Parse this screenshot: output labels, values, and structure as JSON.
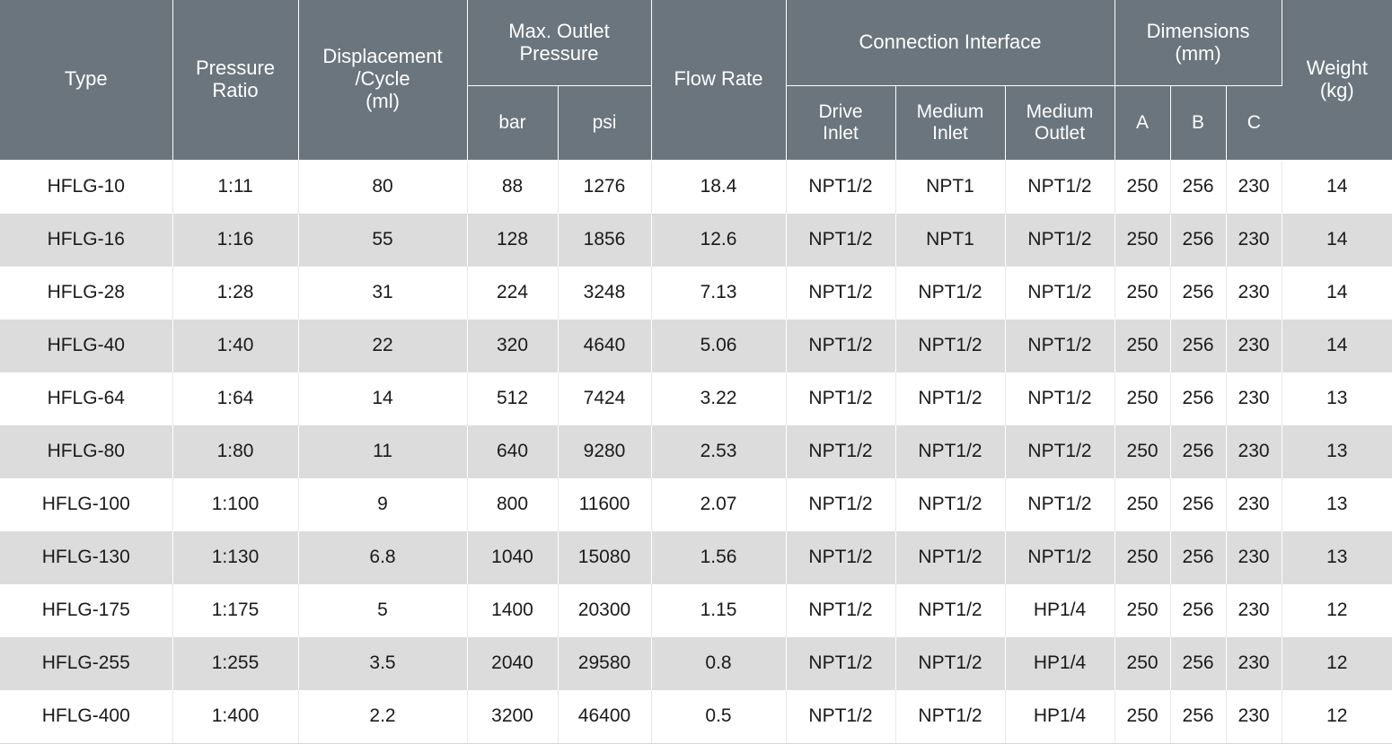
{
  "table": {
    "headers": {
      "type": "Type",
      "pressure_ratio": "Pressure\nRatio",
      "pressure_ratio_l1": "Pressure",
      "pressure_ratio_l2": "Ratio",
      "displacement_l1": "Displacement",
      "displacement_l2": "/Cycle",
      "displacement_l3": "(ml)",
      "max_outlet_pressure_l1": "Max. Outlet",
      "max_outlet_pressure_l2": "Pressure",
      "bar": "bar",
      "psi": "psi",
      "flow_rate": "Flow Rate",
      "connection_interface": "Connection Interface",
      "drive_inlet_l1": "Drive",
      "drive_inlet_l2": "Inlet",
      "medium_inlet_l1": "Medium",
      "medium_inlet_l2": "Inlet",
      "medium_outlet_l1": "Medium",
      "medium_outlet_l2": "Outlet",
      "dimensions_l1": "Dimensions",
      "dimensions_l2": "(mm)",
      "dim_a": "A",
      "dim_b": "B",
      "dim_c": "C",
      "weight_l1": "Weight",
      "weight_l2": "(kg)"
    },
    "rows": [
      {
        "type": "HFLG-10",
        "pressure_ratio": "1:11",
        "displacement": "80",
        "bar": "88",
        "psi": "1276",
        "flow_rate": "18.4",
        "drive_inlet": "NPT1/2",
        "medium_inlet": "NPT1",
        "medium_outlet": "NPT1/2",
        "a": "250",
        "b": "256",
        "c": "230",
        "weight": "14"
      },
      {
        "type": "HFLG-16",
        "pressure_ratio": "1:16",
        "displacement": "55",
        "bar": "128",
        "psi": "1856",
        "flow_rate": "12.6",
        "drive_inlet": "NPT1/2",
        "medium_inlet": "NPT1",
        "medium_outlet": "NPT1/2",
        "a": "250",
        "b": "256",
        "c": "230",
        "weight": "14"
      },
      {
        "type": "HFLG-28",
        "pressure_ratio": "1:28",
        "displacement": "31",
        "bar": "224",
        "psi": "3248",
        "flow_rate": "7.13",
        "drive_inlet": "NPT1/2",
        "medium_inlet": "NPT1/2",
        "medium_outlet": "NPT1/2",
        "a": "250",
        "b": "256",
        "c": "230",
        "weight": "14"
      },
      {
        "type": "HFLG-40",
        "pressure_ratio": "1:40",
        "displacement": "22",
        "bar": "320",
        "psi": "4640",
        "flow_rate": "5.06",
        "drive_inlet": "NPT1/2",
        "medium_inlet": "NPT1/2",
        "medium_outlet": "NPT1/2",
        "a": "250",
        "b": "256",
        "c": "230",
        "weight": "14"
      },
      {
        "type": "HFLG-64",
        "pressure_ratio": "1:64",
        "displacement": "14",
        "bar": "512",
        "psi": "7424",
        "flow_rate": "3.22",
        "drive_inlet": "NPT1/2",
        "medium_inlet": "NPT1/2",
        "medium_outlet": "NPT1/2",
        "a": "250",
        "b": "256",
        "c": "230",
        "weight": "13"
      },
      {
        "type": "HFLG-80",
        "pressure_ratio": "1:80",
        "displacement": "11",
        "bar": "640",
        "psi": "9280",
        "flow_rate": "2.53",
        "drive_inlet": "NPT1/2",
        "medium_inlet": "NPT1/2",
        "medium_outlet": "NPT1/2",
        "a": "250",
        "b": "256",
        "c": "230",
        "weight": "13"
      },
      {
        "type": "HFLG-100",
        "pressure_ratio": "1:100",
        "displacement": "9",
        "bar": "800",
        "psi": "11600",
        "flow_rate": "2.07",
        "drive_inlet": "NPT1/2",
        "medium_inlet": "NPT1/2",
        "medium_outlet": "NPT1/2",
        "a": "250",
        "b": "256",
        "c": "230",
        "weight": "13"
      },
      {
        "type": "HFLG-130",
        "pressure_ratio": "1:130",
        "displacement": "6.8",
        "bar": "1040",
        "psi": "15080",
        "flow_rate": "1.56",
        "drive_inlet": "NPT1/2",
        "medium_inlet": "NPT1/2",
        "medium_outlet": "NPT1/2",
        "a": "250",
        "b": "256",
        "c": "230",
        "weight": "13"
      },
      {
        "type": "HFLG-175",
        "pressure_ratio": "1:175",
        "displacement": "5",
        "bar": "1400",
        "psi": "20300",
        "flow_rate": "1.15",
        "drive_inlet": "NPT1/2",
        "medium_inlet": "NPT1/2",
        "medium_outlet": "HP1/4",
        "a": "250",
        "b": "256",
        "c": "230",
        "weight": "12"
      },
      {
        "type": "HFLG-255",
        "pressure_ratio": "1:255",
        "displacement": "3.5",
        "bar": "2040",
        "psi": "29580",
        "flow_rate": "0.8",
        "drive_inlet": "NPT1/2",
        "medium_inlet": "NPT1/2",
        "medium_outlet": "HP1/4",
        "a": "250",
        "b": "256",
        "c": "230",
        "weight": "12"
      },
      {
        "type": "HFLG-400",
        "pressure_ratio": "1:400",
        "displacement": "2.2",
        "bar": "3200",
        "psi": "46400",
        "flow_rate": "0.5",
        "drive_inlet": "NPT1/2",
        "medium_inlet": "NPT1/2",
        "medium_outlet": "HP1/4",
        "a": "250",
        "b": "256",
        "c": "230",
        "weight": "12"
      }
    ]
  },
  "colors": {
    "header_background": "#6b757d",
    "header_text": "#ffffff",
    "row_alt_background": "#dcdcdc",
    "row_background": "#ffffff",
    "body_text": "#1a1a1a"
  }
}
